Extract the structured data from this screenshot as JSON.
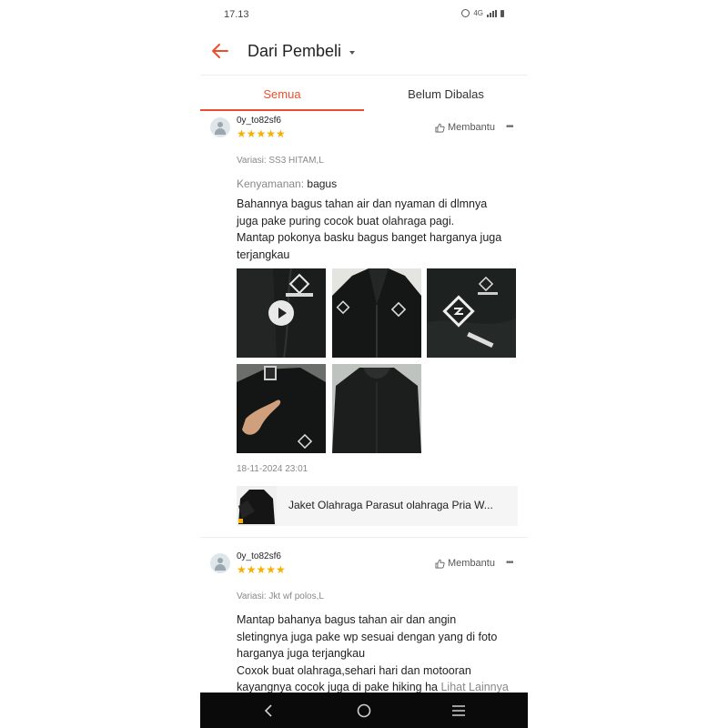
{
  "status_bar": {
    "time": "17.13",
    "network": "4G"
  },
  "header": {
    "title": "Dari Pembeli",
    "back_icon": "arrow-left-icon",
    "dropdown_icon": "caret-down-icon"
  },
  "tabs": [
    {
      "label": "Semua",
      "active": true
    },
    {
      "label": "Belum Dibalas",
      "active": false
    }
  ],
  "colors": {
    "accent": "#ee4d2d",
    "star": "#f6b100"
  },
  "reviews": [
    {
      "username": "0y_to82sf6",
      "rating": 5,
      "stars": "★★★★★",
      "helpful_label": "Membantu",
      "variant": "Variasi: SS3 HITAM,L",
      "comfort_label": "Kenyamanan:",
      "comfort_value": "bagus",
      "lines": [
        "Bahannya bagus tahan air dan nyaman di dlmnya",
        "juga pake puring cocok buat olahraga pagi.",
        "Mantap pokonya basku bagus banget harganya juga",
        "terjangkau"
      ],
      "date": "18-11-2024 23:01",
      "product_name": "Jaket Olahraga Parasut olahraga Pria W..."
    },
    {
      "username": "0y_to82sf6",
      "rating": 5,
      "stars": "★★★★★",
      "helpful_label": "Membantu",
      "variant": "Variasi: Jkt wf polos,L",
      "lines": [
        "Mantap bahanya bagus tahan air dan angin",
        "sletingnya juga pake wp sesuai dengan yang di foto",
        "harganya juga terjangkau",
        "Coxok buat olahraga,sehari hari dan motooran",
        "kayangnya cocok juga di pake hiking ha"
      ],
      "see_more": "Lihat Lainnya"
    }
  ]
}
